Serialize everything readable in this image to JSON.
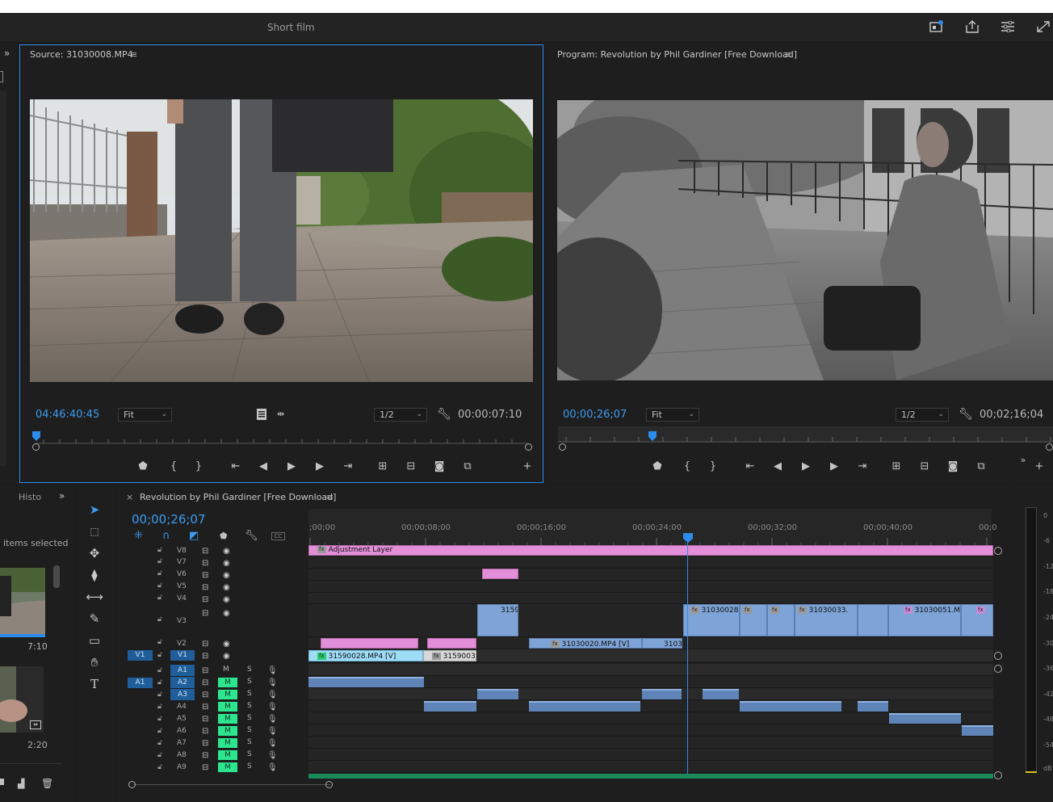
{
  "app": {
    "project_title": "Short film"
  },
  "source": {
    "title": "Source: 31030008.MP4",
    "menu_icon": "≡",
    "timecode": "04:46:40:45",
    "fit": "Fit",
    "resolution": "1/2",
    "duration": "00:00:07:10"
  },
  "program": {
    "title": "Program: Revolution by Phil Gardiner [Free Download]",
    "menu_icon": "≡",
    "timecode": "00;00;26;07",
    "fit": "Fit",
    "resolution": "1/2",
    "duration": "00;02;16;04"
  },
  "bin": {
    "tab": "Histo",
    "selection": "items selected",
    "thumb1_duration": "7:10",
    "thumb2_duration": "2:20"
  },
  "timeline": {
    "title": "Revolution by Phil Gardiner [Free Download]",
    "close": "×",
    "menu_icon": "≡",
    "timecode": "00;00;26;07",
    "ruler_labels": [
      ";00;00",
      "00;00;08;00",
      "00;00;16;00",
      "00;00;24;00",
      "00;00;32;00",
      "00;00;40;00",
      "00;0"
    ],
    "source_patch_video": "V1",
    "source_patch_audio": "A1",
    "video_tracks": [
      "V8",
      "V7",
      "V6",
      "V5",
      "V4",
      "V3",
      "V2",
      "V1"
    ],
    "audio_tracks": [
      "A1",
      "A2",
      "A3",
      "A4",
      "A5",
      "A6",
      "A7",
      "A8",
      "A9"
    ],
    "mute_label": "M",
    "solo_label": "S",
    "clips": {
      "adjustment": "Adjustment Layer",
      "v3_a": "3159",
      "v3_b": "31030028",
      "v3_c": "31030033.",
      "v3_d": "31030051.M",
      "v2_a": "31030020.MP4 [V]",
      "v2_b": "3103",
      "v1_a": "31590028.MP4 [V]",
      "v1_b": "3159003"
    }
  },
  "meter": {
    "labels": [
      "0",
      "-6",
      "-12",
      "-18",
      "-24",
      "-30",
      "-36",
      "-42",
      "-48",
      "-54",
      "dB"
    ]
  },
  "colors": {
    "accent_blue": "#2d8ceb",
    "video_clip": "#7ea3d6",
    "adjustment_clip": "#e38ed8",
    "mute_green": "#2ee58f"
  }
}
